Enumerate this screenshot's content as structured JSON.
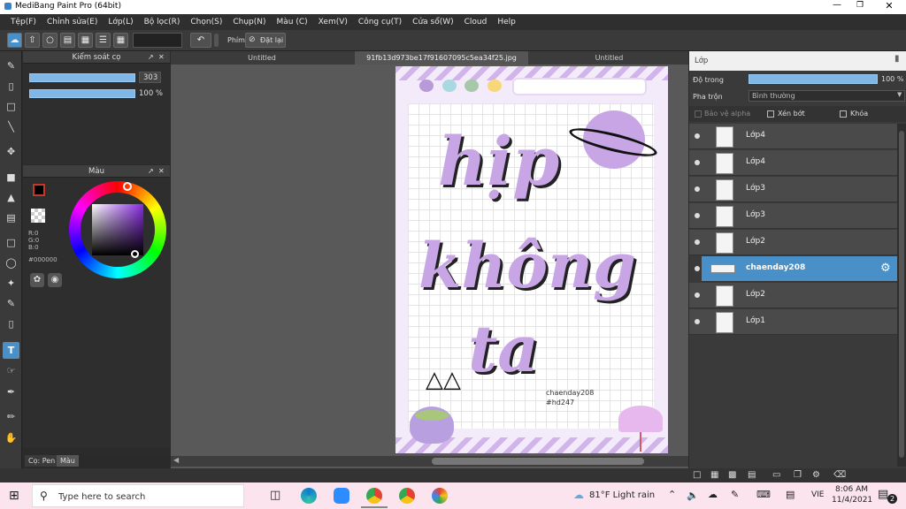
{
  "window": {
    "title": "MediBang Paint Pro (64bit)"
  },
  "menu": [
    "Tệp(F)",
    "Chỉnh sửa(E)",
    "Lớp(L)",
    "Bộ lọc(R)",
    "Chọn(S)",
    "Chụp(N)",
    "Màu (C)",
    "Xem(V)",
    "Công cụ(T)",
    "Cửa sổ(W)",
    "Cloud",
    "Help"
  ],
  "toolbar": {
    "shortcut_label": "Phím",
    "reset_label": "Đặt lại"
  },
  "brush_panel": {
    "title": "Kiểm soát cọ",
    "size_value": "303",
    "opacity_value": "100 %"
  },
  "color_panel": {
    "title": "Màu",
    "r": "R:0",
    "g": "G:0",
    "b": "B:0",
    "hex": "#000000",
    "primary_color": "#000000",
    "accent": "#c0392b"
  },
  "bottom_tabs": {
    "pen": "Cọ: Pen",
    "color": "Màu"
  },
  "doc_tabs": [
    "Untitled",
    "91fb13d973be17f91607095c5ea34f25.jpg",
    "Untitled"
  ],
  "artwork": {
    "line1": "hịp",
    "line2": "không",
    "line3": "ta",
    "credit1": "chaenday208",
    "credit2": "#hd247",
    "lilac": "#c8a6e6"
  },
  "layers_panel": {
    "title": "Lớp",
    "opacity_label": "Độ trong",
    "opacity_value": "100 %",
    "blend_label": "Pha trộn",
    "blend_value": "Bình thường",
    "protect_alpha": "Bảo vệ alpha",
    "clipping": "Xén bớt",
    "lock": "Khóa",
    "items": [
      {
        "name": "Lớp4",
        "selected": false
      },
      {
        "name": "Lớp4",
        "selected": false
      },
      {
        "name": "Lớp3",
        "selected": false
      },
      {
        "name": "Lớp3",
        "selected": false
      },
      {
        "name": "Lớp2",
        "selected": false
      },
      {
        "name": "chaenday208",
        "selected": true
      },
      {
        "name": "Lớp2",
        "selected": false
      },
      {
        "name": "Lớp1",
        "selected": false
      }
    ],
    "selected_color": "#4a90c8"
  },
  "taskbar": {
    "search_placeholder": "Type here to search",
    "weather": "81°F  Light rain",
    "lang": "VIE",
    "time": "8:06 AM",
    "date": "11/4/2021",
    "notif_count": "2"
  }
}
